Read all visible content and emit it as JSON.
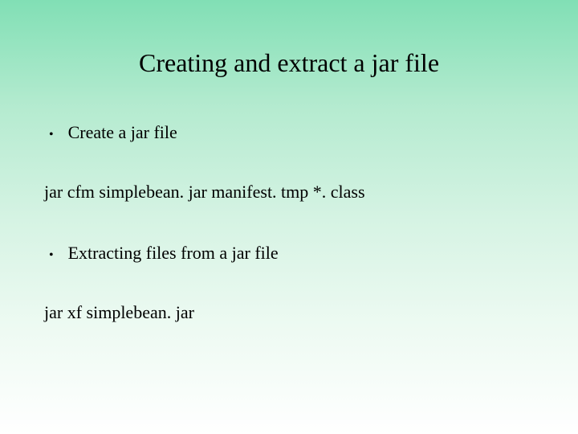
{
  "slide": {
    "title": "Creating and extract a  jar file",
    "bullet1": "Create a jar file",
    "command1": "jar  cfm  simplebean. jar   manifest. tmp     *. class",
    "bullet2": "Extracting files from a jar file",
    "command2": "jar   xf   simplebean. jar"
  }
}
